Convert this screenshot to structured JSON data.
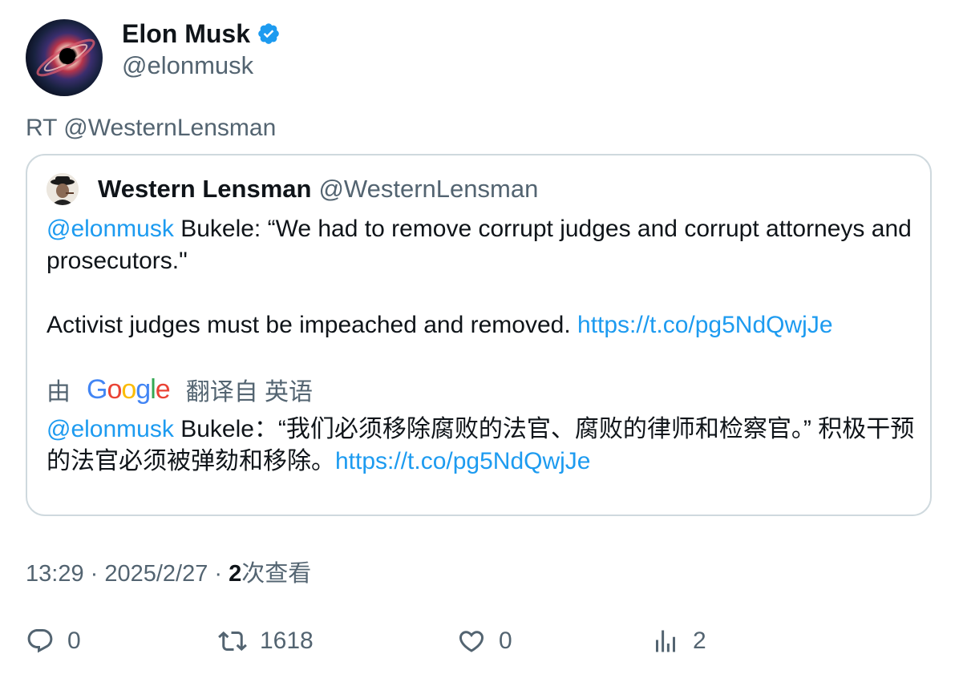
{
  "author": {
    "display_name": "Elon Musk",
    "handle": "@elonmusk",
    "verified_icon": "verified-badge-icon"
  },
  "retweet_line": "RT @WesternLensman",
  "quote": {
    "display_name": "Western Lensman",
    "handle": "@WesternLensman",
    "mention": "@elonmusk",
    "text_line1": " Bukele: “We had to remove corrupt judges and corrupt attorneys and prosecutors.\"",
    "text_line2": "Activist judges must be impeached and removed. ",
    "link": "https://t.co/pg5NdQwjJe",
    "translate_prefix": "由",
    "translate_brand": "Google",
    "translate_suffix": "翻译自 英语",
    "translated_mention": "@elonmusk",
    "translated_text": " Bukele：“我们必须移除腐败的法官、腐败的律师和检察官。” 积极干预的法官必须被弹劾和移除。",
    "translated_link": "https://t.co/pg5NdQwjJe"
  },
  "meta": {
    "time": "13:29",
    "sep1": " · ",
    "date": "2025/2/27",
    "sep2": " · ",
    "views_count": "2",
    "views_label": "次查看"
  },
  "actions": {
    "reply_count": "0",
    "retweet_count": "1618",
    "like_count": "0",
    "views_count": "2"
  },
  "colors": {
    "link": "#1d9bf0",
    "secondary_text": "#536471",
    "border": "#cfd9de"
  }
}
